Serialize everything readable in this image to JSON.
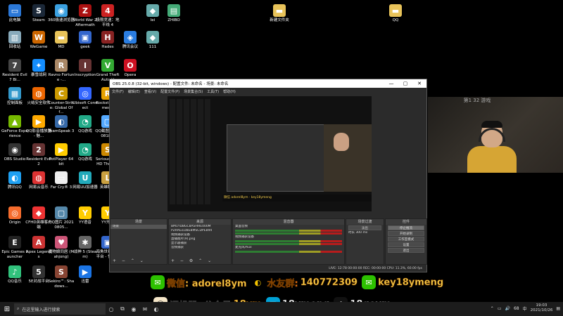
{
  "desktop": {
    "icons": [
      {
        "label": "此电脑",
        "glyph": "▭",
        "color": "#2b78d8"
      },
      {
        "label": "Steam",
        "glyph": "S",
        "color": "#1b2838"
      },
      {
        "label": "360极速浏览器",
        "glyph": "◉",
        "color": "#3aa0e0"
      },
      {
        "label": "World War Z Aftermath",
        "glyph": "Z",
        "color": "#a11"
      },
      {
        "label": "极限竞速：地平线 4",
        "glyph": "4",
        "color": "#c22"
      },
      {
        "label": "lei",
        "glyph": "◆",
        "color": "#6aa"
      },
      {
        "label": "ZHIBO",
        "glyph": "▤",
        "color": "#4a7"
      },
      {
        "label": "新建文件夹",
        "glyph": "▬",
        "color": "#e8c35a"
      },
      {
        "label": "QQ",
        "glyph": "▬",
        "color": "#e8c35a"
      },
      {
        "label": "回收站",
        "glyph": "▥",
        "color": "#8ab"
      },
      {
        "label": "WeGame",
        "glyph": "W",
        "color": "#c60"
      },
      {
        "label": "MD",
        "glyph": "▬",
        "color": "#e8c35a"
      },
      {
        "label": "geek",
        "glyph": "▣",
        "color": "#36c"
      },
      {
        "label": "Hades",
        "glyph": "H",
        "color": "#822"
      },
      {
        "label": "腾讯会议",
        "glyph": "◈",
        "color": "#2a7de1"
      },
      {
        "label": "111",
        "glyph": "◆",
        "color": "#6aa"
      },
      {
        "label": "Resident Evil 7 Bi...",
        "glyph": "7",
        "color": "#444"
      },
      {
        "label": "暴雪战网",
        "glyph": "✦",
        "color": "#148eff"
      },
      {
        "label": "Ravno Fortune -...",
        "glyph": "R",
        "color": "#a86"
      },
      {
        "label": "Inscryption",
        "glyph": "I",
        "color": "#633"
      },
      {
        "label": "Grand Theft Auto V",
        "glyph": "V",
        "color": "#3a3"
      },
      {
        "label": "Opera",
        "glyph": "O",
        "color": "#c12"
      },
      {
        "label": "控制面板",
        "glyph": "▦",
        "color": "#39c"
      },
      {
        "label": "火绒安全软件",
        "glyph": "◍",
        "color": "#e60"
      },
      {
        "label": "Counter-Strike: Global Off...",
        "glyph": "C",
        "color": "#c90"
      },
      {
        "label": "Ubisoft Connect",
        "glyph": "◎",
        "color": "#36f"
      },
      {
        "label": "Rockstar Games...",
        "glyph": "R",
        "color": "#e6a100"
      },
      {
        "label": "GeForce Experience",
        "glyph": "▲",
        "color": "#76b900"
      },
      {
        "label": "QQ影音播放器 - 魅...",
        "glyph": "▶",
        "color": "#fa0"
      },
      {
        "label": "TeamSpeak 3",
        "glyph": "◐",
        "color": "#3669a8"
      },
      {
        "label": "QQ游戏",
        "glyph": "◔",
        "color": "#2a8"
      },
      {
        "label": "QQ截图 20210818...",
        "glyph": "▢",
        "color": "#5af"
      },
      {
        "label": "OBS Studio",
        "glyph": "◉",
        "color": "#333"
      },
      {
        "label": "Resident Evil 2",
        "glyph": "2",
        "color": "#633"
      },
      {
        "label": "PotPlayer 64 bit",
        "glyph": "▶",
        "color": "#fc0"
      },
      {
        "label": "QQ游戏",
        "glyph": "◔",
        "color": "#2a8"
      },
      {
        "label": "Serious Sam HD The Fi...",
        "glyph": "S",
        "color": "#c80"
      },
      {
        "label": "腾讯QQ",
        "glyph": "◐",
        "color": "#1ea0f2"
      },
      {
        "label": "网易云音乐",
        "glyph": "◍",
        "color": "#d33"
      },
      {
        "label": "Far Cry® 3",
        "glyph": "▭",
        "color": "#eee"
      },
      {
        "label": "网易UU加速器",
        "glyph": "U",
        "color": "#2ab"
      },
      {
        "label": "英雄联盟",
        "glyph": "L",
        "color": "#c9a040"
      },
      {
        "label": "Origin",
        "glyph": "◎",
        "color": "#f56c2d"
      },
      {
        "label": "CFHD英雄客户端",
        "glyph": "◆",
        "color": "#e33"
      },
      {
        "label": "QQ图片 20210805...",
        "glyph": "▢",
        "color": "#58a"
      },
      {
        "label": "YY语音",
        "glyph": "Y",
        "color": "#fc0"
      },
      {
        "label": "YY开播",
        "glyph": "Y",
        "color": "#fc0"
      },
      {
        "label": "Epic Games Launcher",
        "glyph": "E",
        "color": "#222"
      },
      {
        "label": "Apex Legends",
        "glyph": "A",
        "color": "#c33"
      },
      {
        "label": "魔物娘同居 (Mahjong)",
        "glyph": "♥",
        "color": "#c57"
      },
      {
        "label": "战神 5 (Steam)",
        "glyph": "✱",
        "color": "#666"
      },
      {
        "label": "海角世界我的平台 - 快捷...",
        "glyph": "▣",
        "color": "#36c"
      },
      {
        "label": "QQ音乐",
        "glyph": "♪",
        "color": "#31c27c"
      },
      {
        "label": "5E对战平台",
        "glyph": "5",
        "color": "#333"
      },
      {
        "label": "Sekiro™: Shadows...",
        "glyph": "S",
        "color": "#843"
      },
      {
        "label": "迅雷",
        "glyph": "▶",
        "color": "#1b74e4"
      }
    ]
  },
  "obs": {
    "title": "OBS 25.0.8 (32-bit, windows) - 配置文件: 未命名 - 场景: 未命名",
    "window_buttons": [
      "—",
      "▢",
      "✕"
    ],
    "menu": [
      "文件(F)",
      "编辑(E)",
      "查看(V)",
      "配置文件(P)",
      "场景集合(S)",
      "工具(T)",
      "帮助(H)"
    ],
    "preview_banner": "微信 adorel8ym  ·  key18ymeng",
    "docks": {
      "scenes": {
        "title": "场景",
        "items": [
          "场景"
        ]
      },
      "sources": {
        "title": "来源",
        "items": [
          "BM1YDBGC8ASHHE000M",
          "PZRAG1DBEBMSCDPEB94",
          "视频捕获设备",
          "直播图片(9).png",
          "显示器捕获",
          "音频捕获"
        ]
      },
      "mixer": {
        "title": "混音器",
        "channels": [
          "桌面音频",
          "视频捕获设备",
          "麦克风/Aux"
        ]
      },
      "transitions": {
        "title": "场景过渡",
        "mode": "淡出",
        "duration_label": "时长",
        "duration": "300 ms"
      },
      "controls": {
        "title": "控件",
        "buttons": [
          "停止推流",
          "开始录制",
          "工作室模式",
          "设置",
          "退出"
        ]
      }
    },
    "status": "LIVE: 12:78   00:00:00   REC: 00:00:00   CPU: 11.3%, 60.00 fps"
  },
  "webcam": {
    "poster_text": "第1 32 游戏"
  },
  "banner": {
    "wechat_text": "微信: adorel8ym",
    "qq_label": "水友群:",
    "qq_number": "140772309",
    "weibo_text": "key18ymeng",
    "recruit_text": "调机器: 公众号",
    "recruit_id": "18ym",
    "bilibili_text": "18ymeng",
    "douyin_text": "18goym"
  },
  "taskbar": {
    "search_placeholder": "在这里输入进行搜索",
    "tray_lang": "中",
    "tray_volume": "68",
    "time": "19:03",
    "date": "2021/10/26"
  }
}
